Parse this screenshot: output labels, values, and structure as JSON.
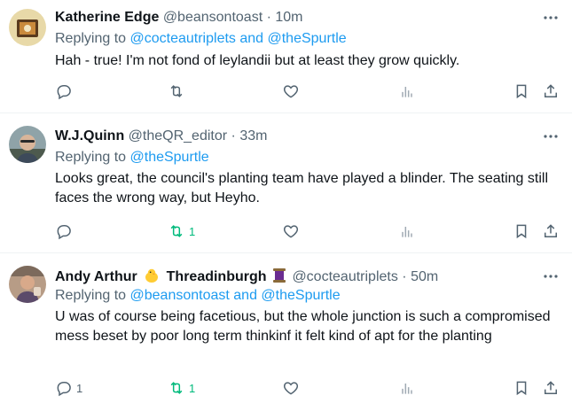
{
  "tweets": [
    {
      "name": "Katherine Edge",
      "handle": "@beansontoast",
      "sep": "·",
      "time": "10m",
      "reply_prefix": "Replying to",
      "reply_to": "@cocteautriplets and @theSpurtle",
      "text": "Hah - true! I'm not fond of leylandii but at least they grow quickly.",
      "reply_count": "",
      "retweet_count": "",
      "like_count": ""
    },
    {
      "name": "W.J.Quinn",
      "handle": "@theQR_editor",
      "sep": "·",
      "time": "33m",
      "reply_prefix": "Replying to",
      "reply_to": "@theSpurtle",
      "text": "Looks great, the council's planting team have played a blinder. The seating still faces the wrong way, but Heyho.",
      "reply_count": "",
      "retweet_count": "1",
      "like_count": ""
    },
    {
      "name": "Andy Arthur",
      "name_suffix": "Threadinburgh",
      "handle": "@cocteautriplets",
      "sep": "·",
      "time": "50m",
      "reply_prefix": "Replying to",
      "reply_to": "@beansontoast and @theSpurtle",
      "text": "U was of course being facetious, but the whole junction is such a compromised mess beset by poor long term thinkinf it felt kind of apt for the planting",
      "reply_count": "1",
      "retweet_count": "1",
      "like_count": ""
    }
  ],
  "icons": [
    "reply-icon",
    "retweet-icon",
    "like-icon",
    "views-icon",
    "bookmark-icon",
    "share-icon",
    "more-icon"
  ],
  "colors": {
    "link": "#1d9bf0",
    "muted": "#536471",
    "retweet_active": "#00ba7c",
    "text": "#0f1419"
  }
}
